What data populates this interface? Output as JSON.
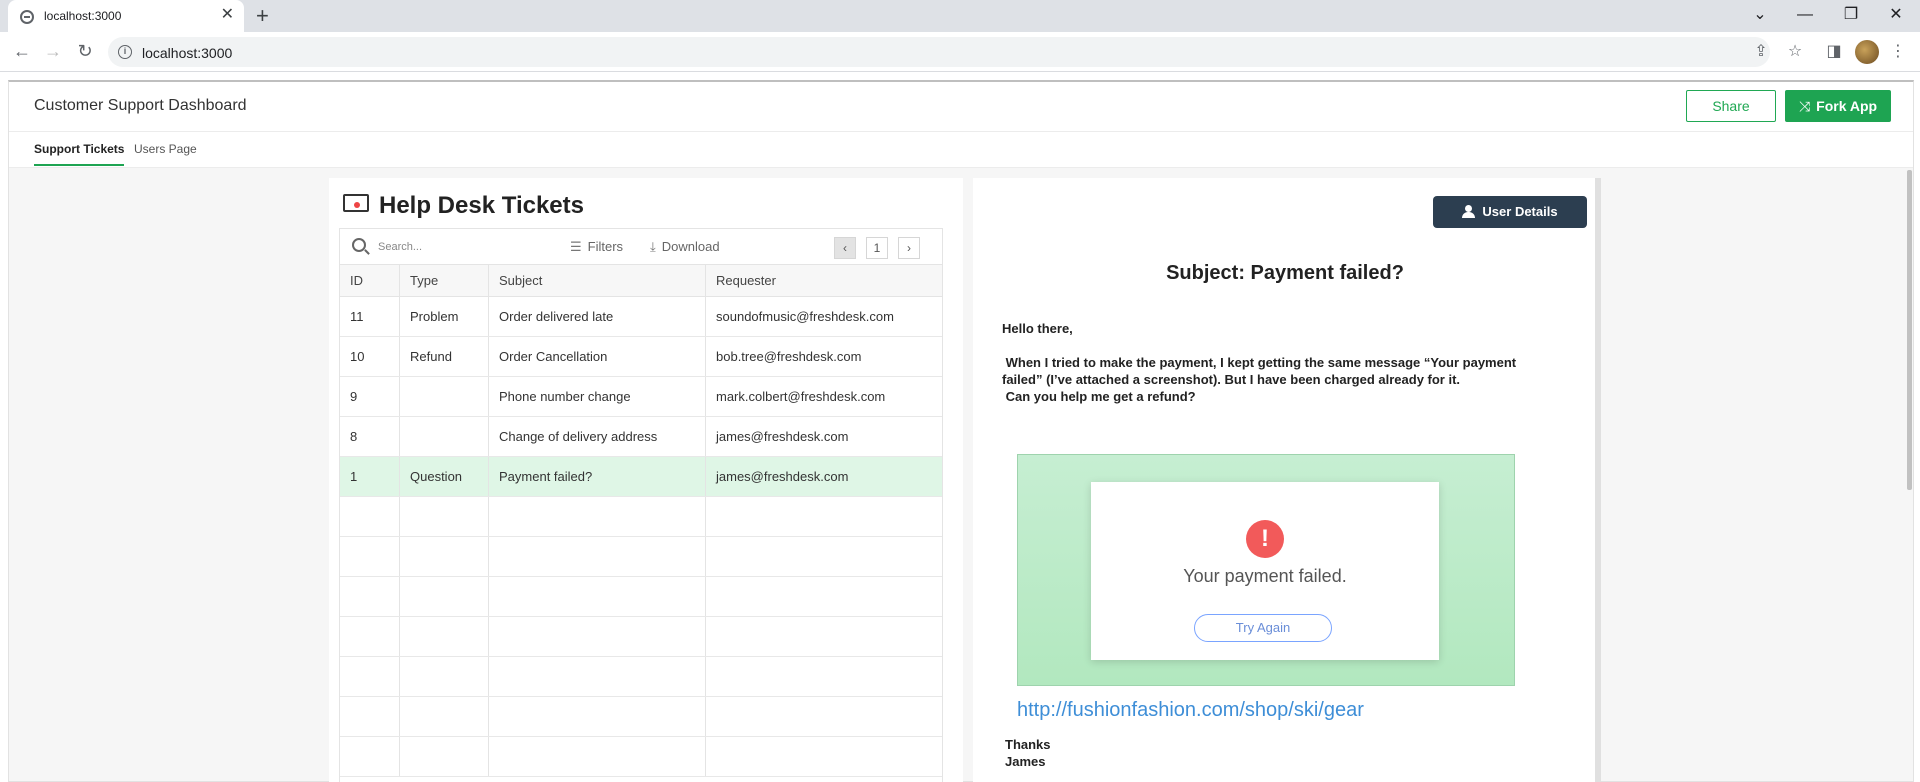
{
  "browser": {
    "tab_title": "localhost:3000",
    "tab_close": "✕",
    "new_tab": "+",
    "url": "localhost:3000",
    "window_controls": {
      "dropdown": "⌄",
      "minimize": "—",
      "restore": "❐",
      "close": "✕"
    },
    "nav": {
      "back": "←",
      "forward": "→",
      "reload": "↻"
    },
    "toolbar_icons": {
      "share": "⇪",
      "bookmark": "☆",
      "sidepanel": "◨",
      "menu": "⋮"
    }
  },
  "header": {
    "title": "Customer Support Dashboard",
    "share_label": "Share",
    "fork_label": "Fork App",
    "fork_icon": "⤨"
  },
  "subnav": {
    "tabs": [
      {
        "label": "Support Tickets",
        "active": true
      },
      {
        "label": "Users Page",
        "active": false
      }
    ]
  },
  "tickets": {
    "title": "Help Desk Tickets",
    "search_placeholder": "Search...",
    "filters_label": "Filters",
    "download_label": "Download",
    "page_prev": "‹",
    "page_number": "1",
    "page_next": "›",
    "columns": [
      "ID",
      "Type",
      "Subject",
      "Requester"
    ],
    "rows": [
      {
        "id": "11",
        "type": "Problem",
        "subject": "Order delivered late",
        "requester": "soundofmusic@freshdesk.com"
      },
      {
        "id": "10",
        "type": "Refund",
        "subject": "Order Cancellation",
        "requester": "bob.tree@freshdesk.com"
      },
      {
        "id": "9",
        "type": "",
        "subject": "Phone number change",
        "requester": "mark.colbert@freshdesk.com"
      },
      {
        "id": "8",
        "type": "",
        "subject": "Change of delivery address",
        "requester": "james@freshdesk.com"
      },
      {
        "id": "1",
        "type": "Question",
        "subject": "Payment failed?",
        "requester": "james@freshdesk.com"
      }
    ]
  },
  "detail": {
    "user_details_label": "User Details",
    "subject": "Subject: Payment failed?",
    "greeting": "Hello there,",
    "body_line1": " When I tried to make the payment, I kept getting the same message “Your payment",
    "body_line2": "failed” (I’ve attached a screenshot). But I have been charged already for it.",
    "body_line3": " Can you help me get a refund?",
    "screenshot": {
      "error_icon": "!",
      "error_text": "Your payment failed.",
      "button_label": "Try Again"
    },
    "link": "http://fushionfashion.com/shop/ski/gear",
    "signoff1": "Thanks",
    "signoff2": "James"
  },
  "colors": {
    "accent_green": "#1ea452",
    "selected_row": "#dff6e6",
    "dark_button": "#2c3e50",
    "link_blue": "#3e8ed7",
    "error_red": "#f25a5a"
  }
}
